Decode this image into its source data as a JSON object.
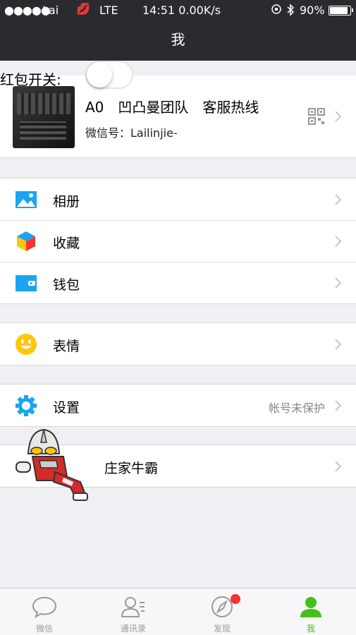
{
  "status_bar": {
    "signal_dots": "●●●●●",
    "carrier": "Lai",
    "network": "LTE",
    "time_speed": "14:51 0.00K/s",
    "battery_text": "90%",
    "battery_level": 0.9
  },
  "nav": {
    "title": "我"
  },
  "hongbao_switch": {
    "label": "红包开关:",
    "on": false
  },
  "profile": {
    "name": "A0　凹凸曼团队　客服热线",
    "wechat_id": "微信号：Lailinjie-"
  },
  "cells": {
    "album": "相册",
    "favorites": "收藏",
    "wallet": "钱包",
    "stickers": "表情",
    "settings": "设置",
    "settings_detail": "帐号未保护",
    "game": "庄家牛霸"
  },
  "tabbar": {
    "tabs": [
      {
        "label": "微信"
      },
      {
        "label": "通讯录"
      },
      {
        "label": "发现"
      },
      {
        "label": "我"
      }
    ]
  },
  "colors": {
    "accent": "#45c01a",
    "badge": "#f43530",
    "nav_bg": "#2b2b2f",
    "icon_blue": "#1aa5f0"
  }
}
